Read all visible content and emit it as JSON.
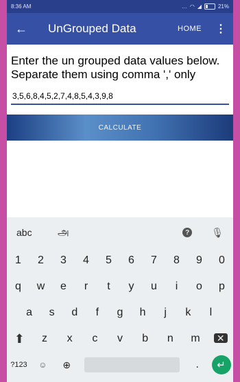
{
  "status_bar": {
    "time": "8:36 AM",
    "battery": "21%"
  },
  "app_bar": {
    "back": "←",
    "title": "UnGrouped Data",
    "home": "HOME",
    "overflow": "⋮"
  },
  "instructions": "Enter the un grouped data values below. Separate them using comma ',' only",
  "input": {
    "value": "3,5,6,8,4,5,2,7,4,8,5,4,3,9,8"
  },
  "calculate": "CALCULATE",
  "keyboard": {
    "mode_label": "abc",
    "language_label": "அ",
    "numbers": [
      "1",
      "2",
      "3",
      "4",
      "5",
      "6",
      "7",
      "8",
      "9",
      "0"
    ],
    "row1": [
      "q",
      "w",
      "e",
      "r",
      "t",
      "y",
      "u",
      "i",
      "o",
      "p"
    ],
    "row2": [
      "a",
      "s",
      "d",
      "f",
      "g",
      "h",
      "j",
      "k",
      "l"
    ],
    "row3": [
      "z",
      "x",
      "c",
      "v",
      "b",
      "n",
      "m"
    ],
    "symbols_label": "?123",
    "period": "."
  }
}
